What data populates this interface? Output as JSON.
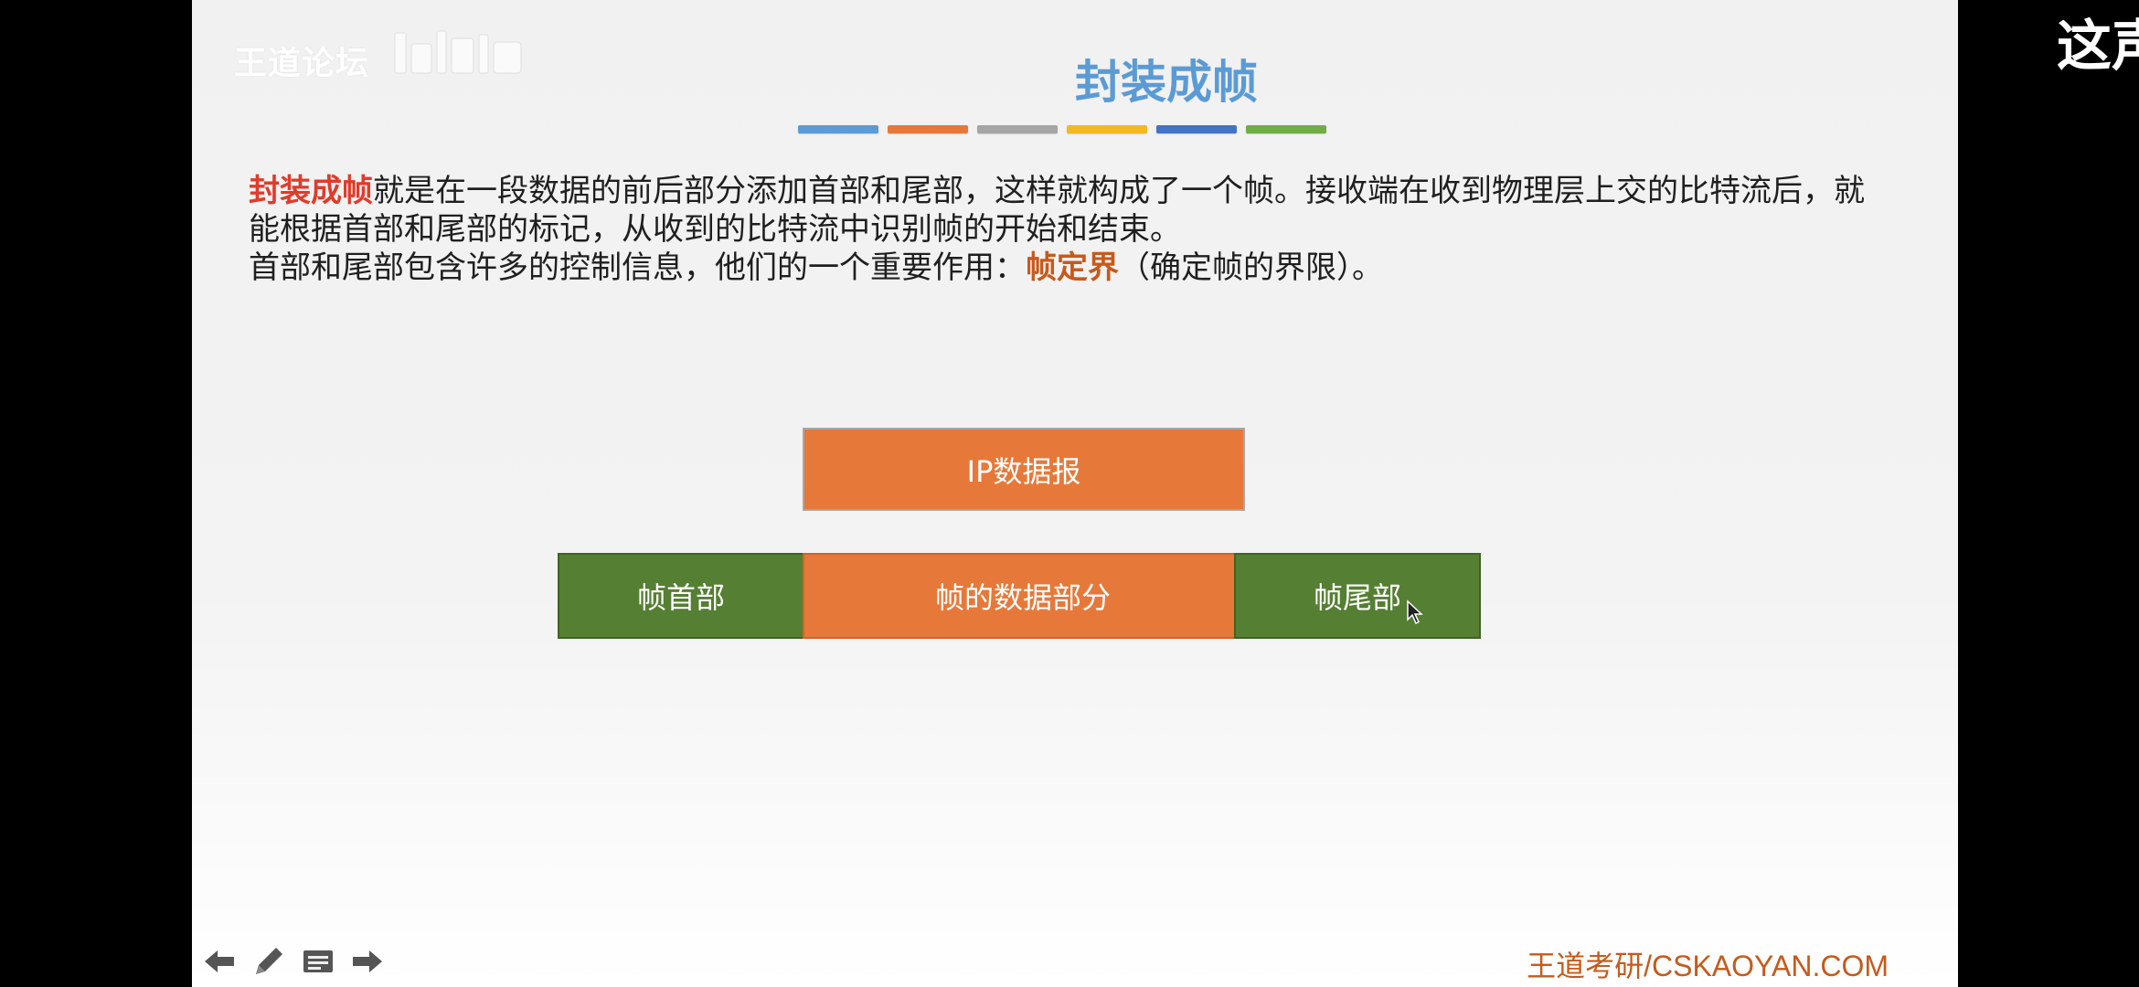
{
  "slide": {
    "forum_logo": "王道论坛",
    "title": "封装成帧",
    "color_bars": [
      "#5b9bd5",
      "#e6793a",
      "#a5a5a5",
      "#f2b923",
      "#4472c4",
      "#70ad47"
    ],
    "paragraph1_highlight": "封装成帧",
    "paragraph1_rest": "就是在一段数据的前后部分添加首部和尾部，这样就构成了一个帧。接收端在收到物理层上交的比特流后，就能根据首部和尾部的标记，从收到的比特流中识别帧的开始和结束。",
    "paragraph2_before": "首部和尾部包含许多的控制信息，他们的一个重要作用：",
    "paragraph2_highlight": "帧定界",
    "paragraph2_after": "（确定帧的界限）。",
    "diagram": {
      "ip_datagram": "IP数据报",
      "frame_header": "帧首部",
      "frame_data": "帧的数据部分",
      "frame_trailer": "帧尾部"
    },
    "footer_site": "王道考研/CSKAOYAN.COM"
  },
  "nav": {
    "icons": [
      "arrow-left-icon",
      "pen-icon",
      "menu-icon",
      "arrow-right-icon"
    ]
  },
  "overlay": {
    "text": "这声"
  },
  "colors": {
    "title": "#5b9bd5",
    "orange": "#e6793a",
    "green": "#557f32",
    "highlight_red": "#e03b2b",
    "highlight_orange": "#c65a1b"
  }
}
